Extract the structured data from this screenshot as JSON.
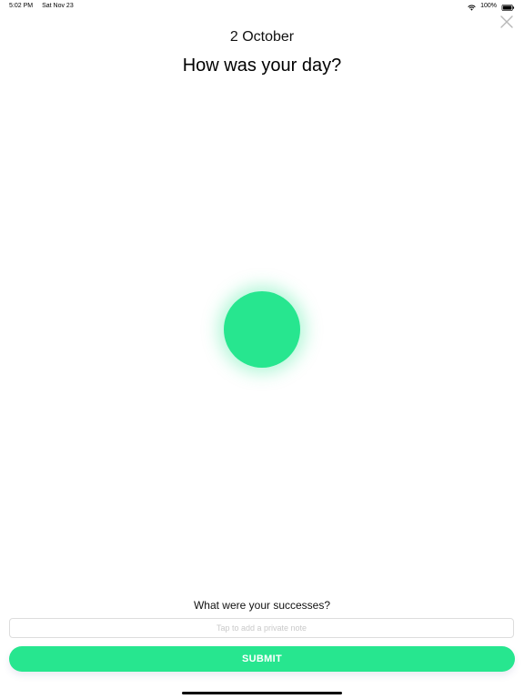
{
  "status_bar": {
    "time": "5:02 PM",
    "date": "Sat Nov 23",
    "battery_percent": "100%",
    "wifi_icon": "wifi-icon",
    "battery_icon": "battery-icon"
  },
  "header": {
    "date": "2 October",
    "title": "How was your day?",
    "close_icon": "close-icon"
  },
  "mood": {
    "color": "#27e68f"
  },
  "successes": {
    "question": "What were your successes?",
    "note_placeholder": "Tap to add a private note",
    "note_value": ""
  },
  "actions": {
    "submit_label": "SUBMIT"
  },
  "colors": {
    "accent": "#27e68f",
    "background": "#ffffff"
  }
}
